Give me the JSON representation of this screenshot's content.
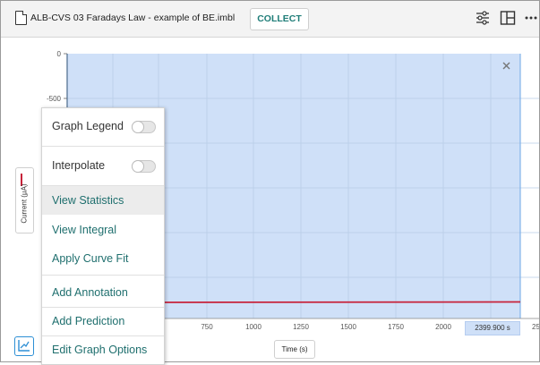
{
  "toolbar": {
    "file_name": "ALB-CVS 03 Faradays Law - example of BE.imbl",
    "collect_label": "COLLECT",
    "icons": [
      "file-icon",
      "sliders-icon",
      "layout-icon",
      "more-icon"
    ]
  },
  "graph": {
    "y_axis_label": "Current (µA)",
    "x_axis_label": "Time (s)",
    "y_ticks": [
      "0",
      "-500"
    ],
    "x_ticks": [
      "750",
      "1000",
      "1250",
      "1500",
      "1750",
      "2000",
      "250"
    ],
    "selection_readout": "2399.900 s",
    "colors": {
      "selection": "#cfe0f8",
      "series": "#c7223a",
      "accent": "#1f6f6e"
    }
  },
  "menu": {
    "graph_legend": "Graph Legend",
    "interpolate": "Interpolate",
    "view_statistics": "View Statistics",
    "view_integral": "View Integral",
    "apply_curve_fit": "Apply Curve Fit",
    "add_annotation": "Add Annotation",
    "add_prediction": "Add Prediction",
    "edit_graph_options": "Edit Graph Options"
  }
}
